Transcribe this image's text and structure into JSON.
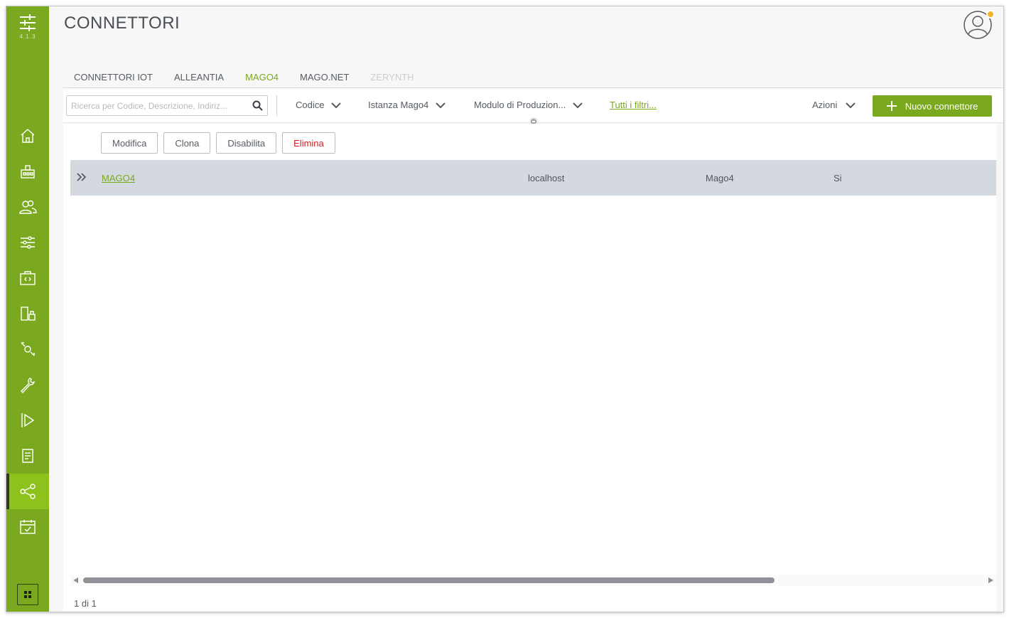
{
  "app": {
    "version": "4.1.3",
    "title": "CONNETTORI"
  },
  "sidebar": {
    "items": [
      {
        "icon": "home-icon"
      },
      {
        "icon": "factory-icon"
      },
      {
        "icon": "users-icon"
      },
      {
        "icon": "sliders-icon"
      },
      {
        "icon": "code-briefcase-icon"
      },
      {
        "icon": "devices-icon"
      },
      {
        "icon": "workflow-icon"
      },
      {
        "icon": "wrench-icon"
      },
      {
        "icon": "play-flag-icon"
      },
      {
        "icon": "document-icon"
      },
      {
        "icon": "share-icon",
        "active": true
      },
      {
        "icon": "calendar-check-icon"
      }
    ],
    "bottom_icon": "grid-icon"
  },
  "tabs": [
    {
      "label": "CONNETTORI IOT",
      "state": "normal"
    },
    {
      "label": "ALLEANTIA",
      "state": "normal"
    },
    {
      "label": "MAGO4",
      "state": "active"
    },
    {
      "label": "MAGO.NET",
      "state": "normal"
    },
    {
      "label": "ZERYNTH",
      "state": "disabled"
    }
  ],
  "toolbar": {
    "search_placeholder": "Ricerca per Codice, Descrizione, Indiriz...",
    "filters": [
      "Codice",
      "Istanza Mago4",
      "Modulo di Produzion..."
    ],
    "all_filters": "Tutti i filtri...",
    "actions_label": "Azioni",
    "new_button": "Nuovo connettore"
  },
  "row_actions": {
    "modify": "Modifica",
    "clone": "Clona",
    "disable": "Disabilita",
    "delete": "Elimina"
  },
  "table": {
    "rows": [
      {
        "name": "MAGO4",
        "host": "localhost",
        "instance": "Mago4",
        "flag": "Si"
      }
    ]
  },
  "pager": {
    "text": "1 di 1"
  },
  "colors": {
    "brand": "#7aa81e",
    "active_nav": "#8cc21b",
    "selected_row": "#d3d9df",
    "danger": "#d21e1e"
  }
}
